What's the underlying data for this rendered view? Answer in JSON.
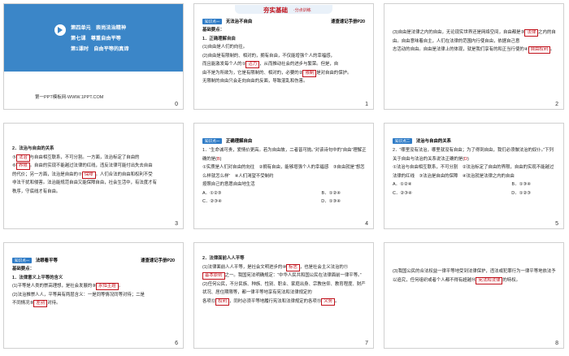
{
  "slides": [
    {
      "number": "0",
      "unit": "第四单元　崇尚法治精神",
      "lesson": "第七课　尊重自由平等",
      "period": "第1课时　自由平等的真谛",
      "site": "第一PPT模板网-WWW.1PPT.COM"
    },
    {
      "number": "1",
      "header_title": "夯实基础",
      "header_sub": "·分点训练",
      "tag": "知识点一",
      "section": "无法治不自由",
      "ref": "速查速记手册P20",
      "basic": "基础要点：",
      "item1": "1．正确理解自由",
      "line_a": "(1)自由是人们的向往。",
      "line_b": "(2)自由是有限制的、相对的，拥有自由，不仅能增强个人的幸福感，",
      "line_c": "而且能激发每个人的①",
      "blank1": "活力",
      "line_d": "，从而推动社会的进步与繁荣。但是，自",
      "line_e": "由不是为所欲为，它是有限制的、相对的，必要的②",
      "blank2": "限制",
      "line_f": "是对自由的保护。",
      "line_g": "无限制的自由只会走向自由的反面，导致混乱和伤害。"
    },
    {
      "number": "2",
      "line_a": "(3)自由是法律之内的自由，无论现实世界还是网络空间，自由都是③",
      "blank1": "法律",
      "line_b": "之内的自由。自由意味着自主，人们在法律的范围内行使自由，依据自己意",
      "line_c": "志活动的自由。自由是法律上的体现，就是我们享有的和正当行使的④",
      "blank2": "自由权利",
      "line_d": "。"
    },
    {
      "number": "3",
      "heading": "2．法治与自由的关系",
      "line_a": "⑤",
      "blank1": "法治",
      "line_b": "与自由相互联系，不可分割。一方面，法治标定了自由的",
      "line_c": "⑥",
      "blank2": "界限",
      "line_d": "。自由的实现不能越过法律的红线，违反法律可能付出失去自由",
      "line_e": "的代价；另一方面，法治是自由的⑦",
      "blank3": "保障",
      "line_f": "。人们合法的自由和权利不受",
      "line_g": "非法干扰和侵害。法治能规范自由又能保障自由，社会生活中，有法度才有",
      "line_h": "秩序，守底线才有自由。"
    },
    {
      "number": "4",
      "tag": "知识点一",
      "section": "正确理解自由",
      "q": "1．“生命诚可贵，爱情价更高。若为自由故，二者皆可抛。”对该诗句中的“自由”理解正确的是(",
      "answer": "B",
      "q_end": ")",
      "o1": "①实质是人们对自由的向往　②拥有自由，能够增强个人的幸福感　③自由就是“想怎么样就怎么样”　④人们渴望不受制约",
      "o2": "按照自己的意愿自由地生活",
      "choices": [
        "A．①②③",
        "B．①②④",
        "C．②③④",
        "D．①③④"
      ]
    },
    {
      "number": "5",
      "tag": "知识点二",
      "section": "法治与自由的关系",
      "q": "2．“哪里没有法治，哪里就没有自由；为了得到自由，我们必须做法治的奴仆。”下列关于自由与法治的关系说法正确的是(",
      "answer": "D",
      "q_end": ")",
      "o1": "①法治与自由相互联系，不可分割　②法治标定了自由的界限，自由的实现不能越过法律的红线　③法治是自由的保障　④法治就是法律之内的自由",
      "choices": [
        "A．①②④",
        "B．①③④",
        "C．②③④",
        "D．①②③"
      ]
    },
    {
      "number": "6",
      "tag": "知识点一",
      "section": "法眼看平等",
      "ref": "速查速记手册P20",
      "basic": "基础要点：",
      "item1": "1．法律意义上平等的含义",
      "line_a": "(1)平等是人类的崇高理想，是社会发展的⑧",
      "blank1": "永恒主题",
      "line_b": "。",
      "line_c": "(2)法治推崇人人，平等具有两层含义：一是同等情况同等对待；二是",
      "line_d": "不同情况⑨",
      "blank2": "差别",
      "line_e": "对待。"
    },
    {
      "number": "7",
      "heading": "2．法律面前人人平等",
      "line_a": "(1)法律面前人人平等，是社会文明进步的⑩",
      "blank1": "标志",
      "line_b": "，也是社会主义法治的⑪",
      "blank2": "基本原则",
      "line_c": "之一。我国宪法明确规定：“中华人民共和国公民在法律面前一律平等。”",
      "line_d": "(2)任何公民，不分民族、种族、性别、职业、家庭出身、宗教信仰、教育程度、财产状况、居住期限等，都一律平等地享有宪法和法律规定的",
      "line_e": "各项⑫",
      "blank3": "权利",
      "line_f": "，同时必须平等地履行宪法和法律规定的各项⑬",
      "blank4": "义务",
      "line_g": "。"
    },
    {
      "number": "8",
      "line_a": "(3)我国公民的合法权益一律平等地受到法律保护，违法或犯罪行为一律平等地依法予以追究，任何组织或者个人都不得有超越⑭",
      "blank1": "宪法和法律",
      "line_b": "的特权。"
    }
  ]
}
